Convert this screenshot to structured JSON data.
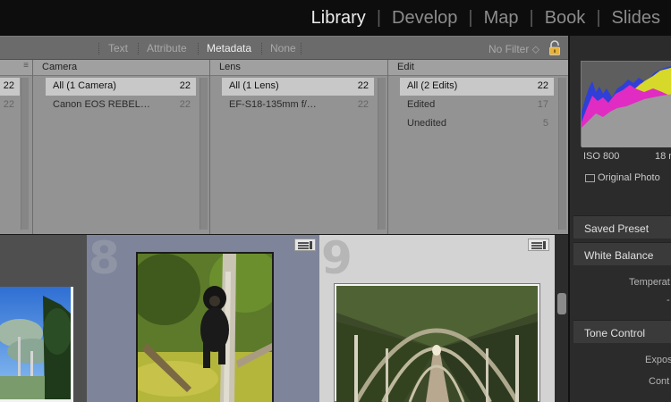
{
  "modules": [
    "Library",
    "Develop",
    "Map",
    "Book",
    "Slides"
  ],
  "active_module": "Library",
  "filter_bar": {
    "text": "Text",
    "attribute": "Attribute",
    "metadata": "Metadata",
    "none": "None",
    "preset": "No Filter ⬦"
  },
  "browser": {
    "partial_counts": [
      "22",
      "22"
    ],
    "columns": [
      {
        "title": "Camera",
        "rows": [
          {
            "label": "All (1 Camera)",
            "count": "22"
          },
          {
            "label": "Canon EOS REBEL…",
            "count": "22"
          }
        ]
      },
      {
        "title": "Lens",
        "rows": [
          {
            "label": "All (1 Lens)",
            "count": "22"
          },
          {
            "label": "EF-S18-135mm f/…",
            "count": "22"
          }
        ]
      },
      {
        "title": "Edit",
        "rows": [
          {
            "label": "All (2 Edits)",
            "count": "22"
          },
          {
            "label": "Edited",
            "count": "17"
          },
          {
            "label": "Unedited",
            "count": "5"
          }
        ]
      }
    ]
  },
  "grid": {
    "cells": [
      {
        "number": "8"
      },
      {
        "number": "9"
      }
    ]
  },
  "right_panel": {
    "iso": "ISO 800",
    "focal": "18 m",
    "original_photo": "Original Photo",
    "saved_preset": "Saved Preset",
    "white_balance": "White Balance",
    "temperature": "Temperat",
    "tone_control": "Tone Control",
    "exposure": "Expos",
    "contrast": "Cont"
  }
}
